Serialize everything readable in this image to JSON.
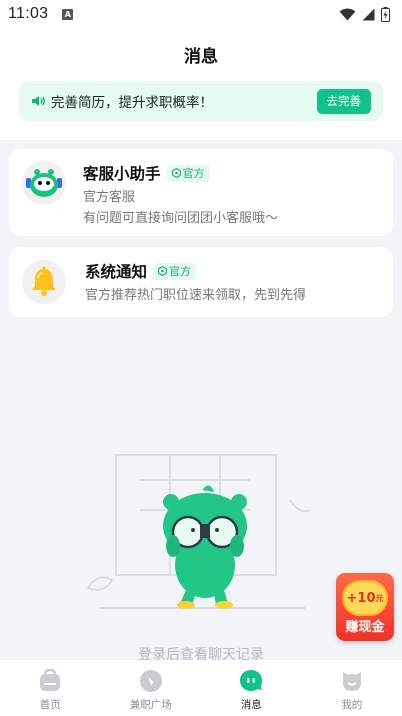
{
  "status_bar": {
    "time": "11:03",
    "notif_icon": "A"
  },
  "header": {
    "title": "消息"
  },
  "banner": {
    "text": "完善简历，提升求职概率！",
    "button": "去完善"
  },
  "conversations": [
    {
      "name": "客服小助手",
      "badge": "官方",
      "line1": "官方客服",
      "line2": "有问题可直接询问团团小客服哦～",
      "icon": "robot-avatar-icon"
    },
    {
      "name": "系统通知",
      "badge": "官方",
      "line1": "官方推荐热门职位速来领取，先到先得",
      "icon": "bell-icon"
    }
  ],
  "empty_state": {
    "text": "登录后查看聊天记录"
  },
  "float_reward": {
    "coin": "+10",
    "coin_unit": "元",
    "label": "赚现金"
  },
  "tabs": [
    {
      "label": "首页",
      "icon": "home-icon",
      "active": false
    },
    {
      "label": "兼职广场",
      "icon": "plaza-icon",
      "active": false
    },
    {
      "label": "消息",
      "icon": "message-icon",
      "active": true
    },
    {
      "label": "我的",
      "icon": "profile-icon",
      "active": false
    }
  ],
  "colors": {
    "accent": "#12c28e",
    "banner_bg": "#e4faf2",
    "reward_red": "#f03127",
    "page_bg": "#f3f4f8"
  }
}
